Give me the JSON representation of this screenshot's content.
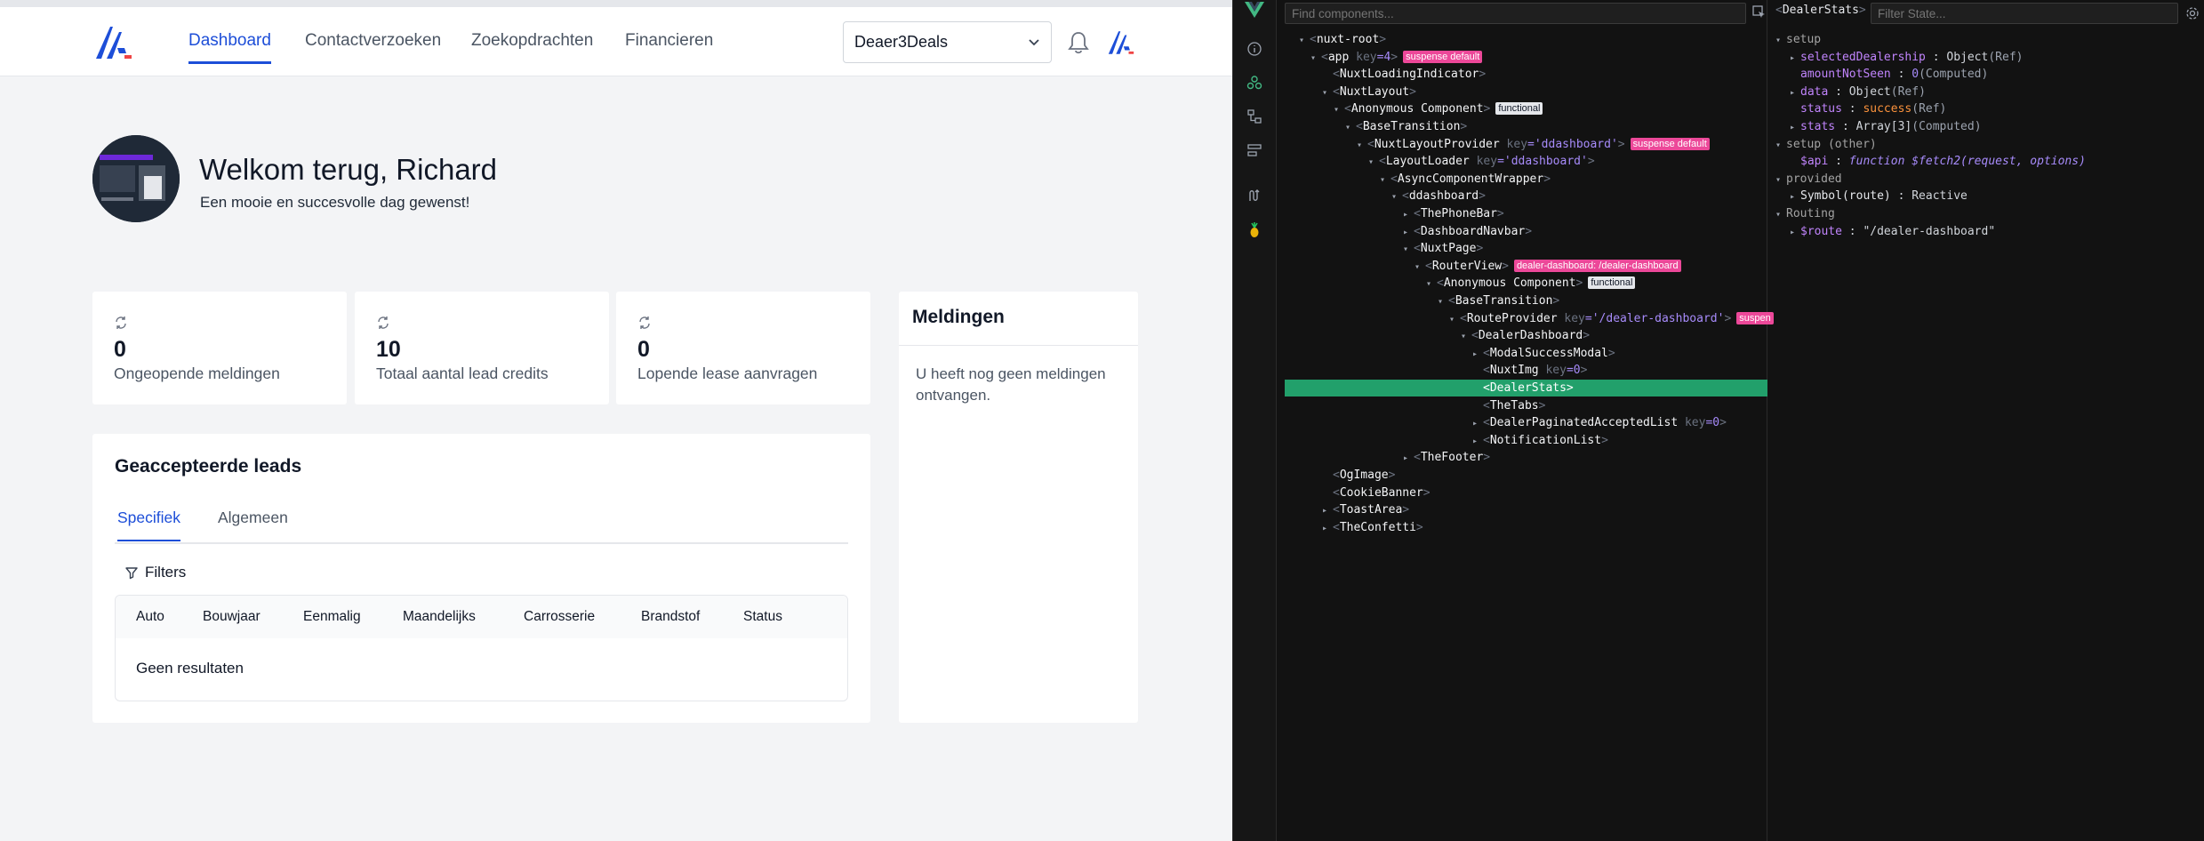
{
  "navbar": {
    "links": [
      "Dashboard",
      "Contactverzoeken",
      "Zoekopdrachten",
      "Financieren"
    ],
    "active_link": "Dashboard",
    "dealer_select": "Deaer3Deals"
  },
  "welcome": {
    "title": "Welkom terug, Richard",
    "subtitle": "Een mooie en succesvolle dag gewenst!"
  },
  "stats": [
    {
      "value": "0",
      "label": "Ongeopende meldingen"
    },
    {
      "value": "10",
      "label": "Totaal aantal lead credits"
    },
    {
      "value": "0",
      "label": "Lopende lease aanvragen"
    }
  ],
  "notifications": {
    "title": "Meldingen",
    "empty": "U heeft nog geen meldingen ontvangen."
  },
  "leads": {
    "title": "Geaccepteerde leads",
    "tabs": [
      "Specifiek",
      "Algemeen"
    ],
    "active_tab": "Specifiek",
    "filters_label": "Filters",
    "columns": [
      "Auto",
      "Bouwjaar",
      "Eenmalig",
      "Maandelijks",
      "Carrosserie",
      "Brandstof",
      "Status"
    ],
    "empty": "Geen resultaten"
  },
  "devtools": {
    "search_placeholder": "Find components...",
    "tree": [
      {
        "indent": 0,
        "arrow": "▾",
        "name": "nuxt-root"
      },
      {
        "indent": 1,
        "arrow": "▾",
        "name": "app",
        "key": "key",
        "kv": "=4",
        "badges": [
          {
            "text": "suspense default",
            "color": "pink"
          }
        ]
      },
      {
        "indent": 2,
        "arrow": "",
        "name": "NuxtLoadingIndicator"
      },
      {
        "indent": 2,
        "arrow": "▾",
        "name": "NuxtLayout"
      },
      {
        "indent": 3,
        "arrow": "▾",
        "name": "Anonymous Component",
        "badges": [
          {
            "text": "functional",
            "color": "white"
          }
        ]
      },
      {
        "indent": 4,
        "arrow": "▾",
        "name": "BaseTransition"
      },
      {
        "indent": 5,
        "arrow": "▾",
        "name": "NuxtLayoutProvider",
        "key": "key",
        "kv": "='ddashboard'",
        "badges": [
          {
            "text": "suspense default",
            "color": "pink"
          }
        ]
      },
      {
        "indent": 6,
        "arrow": "▾",
        "name": "LayoutLoader",
        "key": "key",
        "kv": "='ddashboard'"
      },
      {
        "indent": 7,
        "arrow": "▾",
        "name": "AsyncComponentWrapper"
      },
      {
        "indent": 8,
        "arrow": "▾",
        "name": "ddashboard"
      },
      {
        "indent": 9,
        "arrow": "▸",
        "name": "ThePhoneBar"
      },
      {
        "indent": 9,
        "arrow": "▸",
        "name": "DashboardNavbar"
      },
      {
        "indent": 9,
        "arrow": "▾",
        "name": "NuxtPage"
      },
      {
        "indent": 10,
        "arrow": "▾",
        "name": "RouterView",
        "badges": [
          {
            "text": "dealer-dashboard: /dealer-dashboard",
            "color": "pink"
          }
        ]
      },
      {
        "indent": 11,
        "arrow": "▾",
        "name": "Anonymous Component",
        "badges": [
          {
            "text": "functional",
            "color": "white"
          }
        ]
      },
      {
        "indent": 12,
        "arrow": "▾",
        "name": "BaseTransition"
      },
      {
        "indent": 13,
        "arrow": "▾",
        "name": "RouteProvider",
        "key": "key",
        "kv": "='/dealer-dashboard'",
        "badges": [
          {
            "text": "suspen",
            "color": "pink"
          }
        ]
      },
      {
        "indent": 14,
        "arrow": "▾",
        "name": "DealerDashboard"
      },
      {
        "indent": 15,
        "arrow": "▸",
        "name": "ModalSuccessModal"
      },
      {
        "indent": 15,
        "arrow": "",
        "name": "NuxtImg",
        "key": "key",
        "kv": "=0"
      },
      {
        "indent": 15,
        "arrow": "",
        "name": "DealerStats",
        "selected": true
      },
      {
        "indent": 15,
        "arrow": "",
        "name": "TheTabs"
      },
      {
        "indent": 15,
        "arrow": "▸",
        "name": "DealerPaginatedAcceptedList",
        "key": "key",
        "kv": "=0"
      },
      {
        "indent": 15,
        "arrow": "▸",
        "name": "NotificationList"
      },
      {
        "indent": 9,
        "arrow": "▸",
        "name": "TheFooter"
      },
      {
        "indent": 2,
        "arrow": "",
        "name": "OgImage"
      },
      {
        "indent": 2,
        "arrow": "",
        "name": "CookieBanner"
      },
      {
        "indent": 2,
        "arrow": "▸",
        "name": "ToastArea"
      },
      {
        "indent": 2,
        "arrow": "▸",
        "name": "TheConfetti"
      }
    ],
    "state_header": "DealerStats",
    "state_filter_placeholder": "Filter State...",
    "state_rows": [
      {
        "indent": 0,
        "arrow": "▾",
        "section": "setup"
      },
      {
        "indent": 1,
        "arrow": "▸",
        "key": "selectedDealership",
        "type": "Object",
        "tag": "(Ref)"
      },
      {
        "indent": 1,
        "arrow": "",
        "key": "amountNotSeen",
        "num": "0",
        "tag": "(Computed)"
      },
      {
        "indent": 1,
        "arrow": "▸",
        "key": "data",
        "type": "Object",
        "tag": "(Ref)"
      },
      {
        "indent": 1,
        "arrow": "",
        "key": "status",
        "str": "success",
        "tag": "(Ref)"
      },
      {
        "indent": 1,
        "arrow": "▸",
        "key": "stats",
        "type": "Array[3]",
        "tag": "(Computed)"
      },
      {
        "indent": 0,
        "arrow": "▾",
        "section": "setup (other)"
      },
      {
        "indent": 1,
        "arrow": "",
        "key": "$api",
        "fn": "function $fetch2(request, options)"
      },
      {
        "indent": 0,
        "arrow": "▾",
        "section": "provided"
      },
      {
        "indent": 1,
        "arrow": "▸",
        "plainkey": "Symbol(route)",
        "type": "Reactive"
      },
      {
        "indent": 0,
        "arrow": "▾",
        "section": "Routing"
      },
      {
        "indent": 1,
        "arrow": "▸",
        "key": "$route",
        "type": "\"/dealer-dashboard\""
      }
    ]
  }
}
